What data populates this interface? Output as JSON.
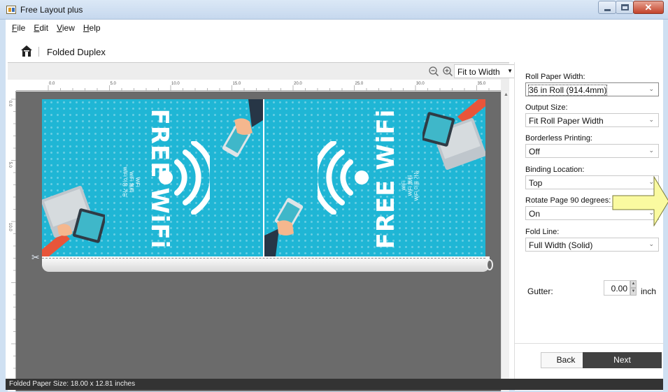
{
  "window": {
    "title": "Free Layout plus"
  },
  "menu": [
    "File",
    "Edit",
    "View",
    "Help"
  ],
  "header": {
    "breadcrumb": "Folded Duplex",
    "home_icon": "home-icon"
  },
  "preview": {
    "zoom": "Fit to Width",
    "ruler_h": [
      "0.0",
      "5.0",
      "10.0",
      "15.0",
      "20.0",
      "25.0",
      "30.0",
      "35.0"
    ],
    "ruler_v": [
      "0.0",
      "5.0",
      "10.0"
    ],
    "poster_title": "FREE WiFi",
    "poster_subtitle_lines": [
      "WiFi",
      "WiFi 無料",
      "WiFi 이용 가능"
    ],
    "page_color": "#1fb6d5",
    "canvas_color": "#6b6b6b"
  },
  "settings": {
    "roll_paper_width": {
      "label": "Roll Paper Width:",
      "value": "36 in Roll (914.4mm)"
    },
    "output_size": {
      "label": "Output Size:",
      "value": "Fit Roll Paper Width"
    },
    "borderless": {
      "label": "Borderless Printing:",
      "value": "Off"
    },
    "binding": {
      "label": "Binding Location:",
      "value": "Top"
    },
    "rotate": {
      "label": "Rotate Page 90 degrees:",
      "value": "On"
    },
    "fold_line": {
      "label": "Fold Line:",
      "value": "Full Width (Solid)"
    },
    "gutter": {
      "label": "Gutter:",
      "value": "0.00",
      "unit": "inch"
    }
  },
  "buttons": {
    "back": "Back",
    "next": "Next"
  },
  "status": "Folded Paper Size: 18.00 x 12.81 inches",
  "callout_arrow_color": "#fafaa0"
}
